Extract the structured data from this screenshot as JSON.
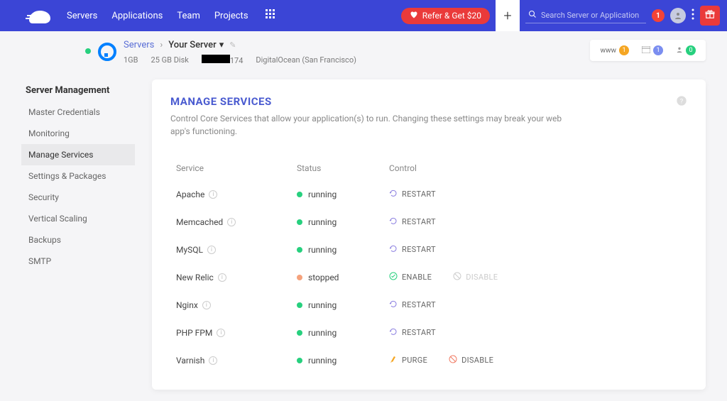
{
  "nav": {
    "links": [
      "Servers",
      "Applications",
      "Team",
      "Projects"
    ]
  },
  "refer": {
    "label": "Refer & Get $20"
  },
  "search": {
    "placeholder": "Search Server or Application"
  },
  "notifications_count": "1",
  "breadcrumb": {
    "servers": "Servers",
    "current": "Your Server"
  },
  "server_meta": {
    "ram": "1GB",
    "disk": "25 GB Disk",
    "ip_suffix": "174",
    "provider": "DigitalOcean (San Francisco)"
  },
  "header_stats": {
    "www_label": "www",
    "www": "1",
    "apps": "1",
    "users": "0"
  },
  "sidebar": {
    "title": "Server Management",
    "items": [
      "Master Credentials",
      "Monitoring",
      "Manage Services",
      "Settings & Packages",
      "Security",
      "Vertical Scaling",
      "Backups",
      "SMTP"
    ]
  },
  "panel": {
    "title": "MANAGE SERVICES",
    "desc": "Control Core Services that allow your application(s) to run. Changing these settings may break your web app's functioning.",
    "cols": {
      "service": "Service",
      "status": "Status",
      "control": "Control"
    }
  },
  "status_labels": {
    "running": "running",
    "stopped": "stopped"
  },
  "ctl_labels": {
    "restart": "RESTART",
    "enable": "ENABLE",
    "disable": "DISABLE",
    "purge": "PURGE"
  },
  "services": [
    {
      "name": "Apache",
      "status": "running",
      "controls": [
        "restart"
      ]
    },
    {
      "name": "Memcached",
      "status": "running",
      "controls": [
        "restart"
      ]
    },
    {
      "name": "MySQL",
      "status": "running",
      "controls": [
        "restart"
      ]
    },
    {
      "name": "New Relic",
      "status": "stopped",
      "controls": [
        "enable",
        "disable_disabled"
      ]
    },
    {
      "name": "Nginx",
      "status": "running",
      "controls": [
        "restart"
      ]
    },
    {
      "name": "PHP FPM",
      "status": "running",
      "controls": [
        "restart"
      ]
    },
    {
      "name": "Varnish",
      "status": "running",
      "controls": [
        "purge",
        "disable"
      ]
    }
  ]
}
